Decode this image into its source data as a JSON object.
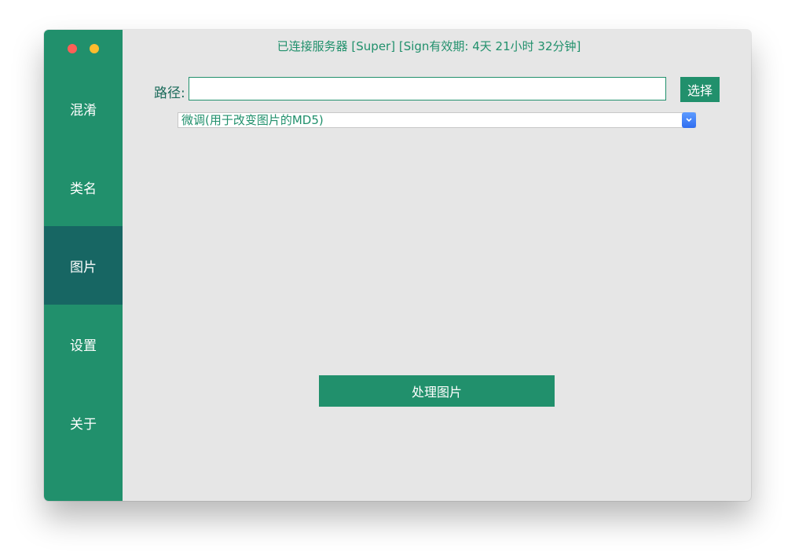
{
  "colors": {
    "accent": "#21906c",
    "active_nav": "#176663",
    "content_bg": "#e6e6e6",
    "traffic_close": "#ff5f57",
    "traffic_min": "#febc2e"
  },
  "status_text": "已连接服务器 [Super] [Sign有效期: 4天 21小时 32分钟]",
  "sidebar": {
    "items": [
      {
        "label": "混淆"
      },
      {
        "label": "类名"
      },
      {
        "label": "图片"
      },
      {
        "label": "设置"
      },
      {
        "label": "关于"
      }
    ],
    "active": "图片"
  },
  "path": {
    "label": "路径:",
    "value": "",
    "select_label": "选择"
  },
  "mode_select": {
    "selected": "微调(用于改变图片的MD5)"
  },
  "process_button_label": "处理图片"
}
